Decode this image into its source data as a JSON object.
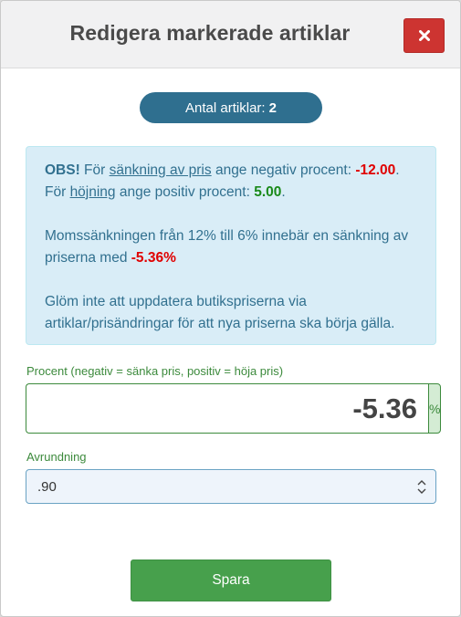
{
  "dialog": {
    "title": "Redigera markerade artiklar",
    "close_icon": "close-icon",
    "close_color": "#cd3431"
  },
  "count": {
    "label": "Antal artiklar:",
    "value": "2"
  },
  "notice": {
    "obs": "OBS!",
    "line1_pre": " För ",
    "decrease_link": "sänkning av pris",
    "line1_mid": " ange negativ procent: ",
    "negative_example": "-12.00",
    "line1_end": ".",
    "line2_pre": "För ",
    "increase_link": "höjning",
    "line2_mid": " ange positiv procent: ",
    "positive_example": "5.00",
    "line2_end": ".",
    "vat_text": "Momssänkningen från 12% till 6% innebär en sänkning av priserna med ",
    "vat_value": "-5.36%",
    "reminder": "Glöm inte att uppdatera butikspriserna via artiklar/prisändringar för att nya priserna ska börja gälla."
  },
  "percent_field": {
    "label": "Procent (negativ = sänka pris, positiv = höja pris)",
    "value": "-5.36",
    "addon": "%"
  },
  "rounding_field": {
    "label": "Avrundning",
    "selected": ".90"
  },
  "actions": {
    "save_label": "Spara"
  },
  "colors": {
    "accent_green": "#47a04c",
    "badge_blue": "#2f6f8f",
    "info_bg": "#d9edf7",
    "negative_red": "#e00000",
    "positive_green": "#1a8a1a"
  }
}
